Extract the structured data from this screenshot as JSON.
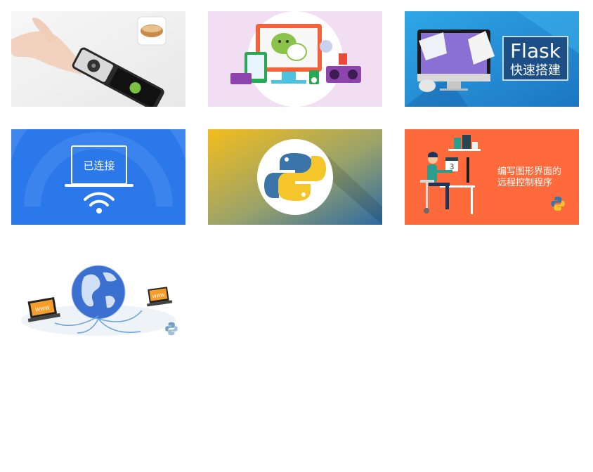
{
  "grid": {
    "cards": [
      {
        "id": "remote-phone-wechat",
        "caption": ""
      },
      {
        "id": "wechat-devices",
        "caption": ""
      },
      {
        "id": "flask",
        "title": "Flask",
        "subtitle": "快速搭建"
      },
      {
        "id": "wifi-connected",
        "badge": "已连接"
      },
      {
        "id": "python-logo",
        "caption": ""
      },
      {
        "id": "gui-remote-control",
        "title_line1": "编写图形界面的",
        "title_line2": "远程控制程序"
      },
      {
        "id": "globe-network",
        "laptop_left": "WWW",
        "laptop_right": "WWW"
      }
    ]
  },
  "colors": {
    "flask_bg": "#1f8fd6",
    "wifi_bg": "#2a78ea",
    "gui_bg": "#ff6a3c",
    "wechat_bg": "#f1def2",
    "python_blue": "#3b74a8",
    "python_yellow": "#f4c62b"
  },
  "icons": [
    "wifi-icon",
    "python-logo-icon",
    "wechat-icon",
    "apple-imac-icon",
    "globe-icon",
    "laptop-icon",
    "calendar-icon"
  ]
}
